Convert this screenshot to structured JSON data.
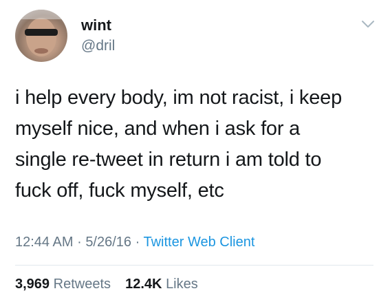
{
  "tweet": {
    "author_name": "wint",
    "author_handle": "@dril",
    "text_lines": [
      "i help every body, im not racist, i keep",
      "myself nice, and when i ask for a",
      "single re-tweet in return i am told to",
      "fuck off, fuck myself, etc"
    ],
    "time": "12:44 AM",
    "separator": "·",
    "date": "5/26/16",
    "client": "Twitter Web Client",
    "retweets_count": "3,969",
    "retweets_label": "Retweets",
    "likes_count": "12.4K",
    "likes_label": "Likes",
    "icons": {
      "menu": "chevron-down-icon",
      "avatar": "avatar"
    }
  },
  "colors": {
    "text": "#14171a",
    "secondary_text": "#657786",
    "link": "#1b95e0",
    "divider": "#e1e8ed"
  }
}
